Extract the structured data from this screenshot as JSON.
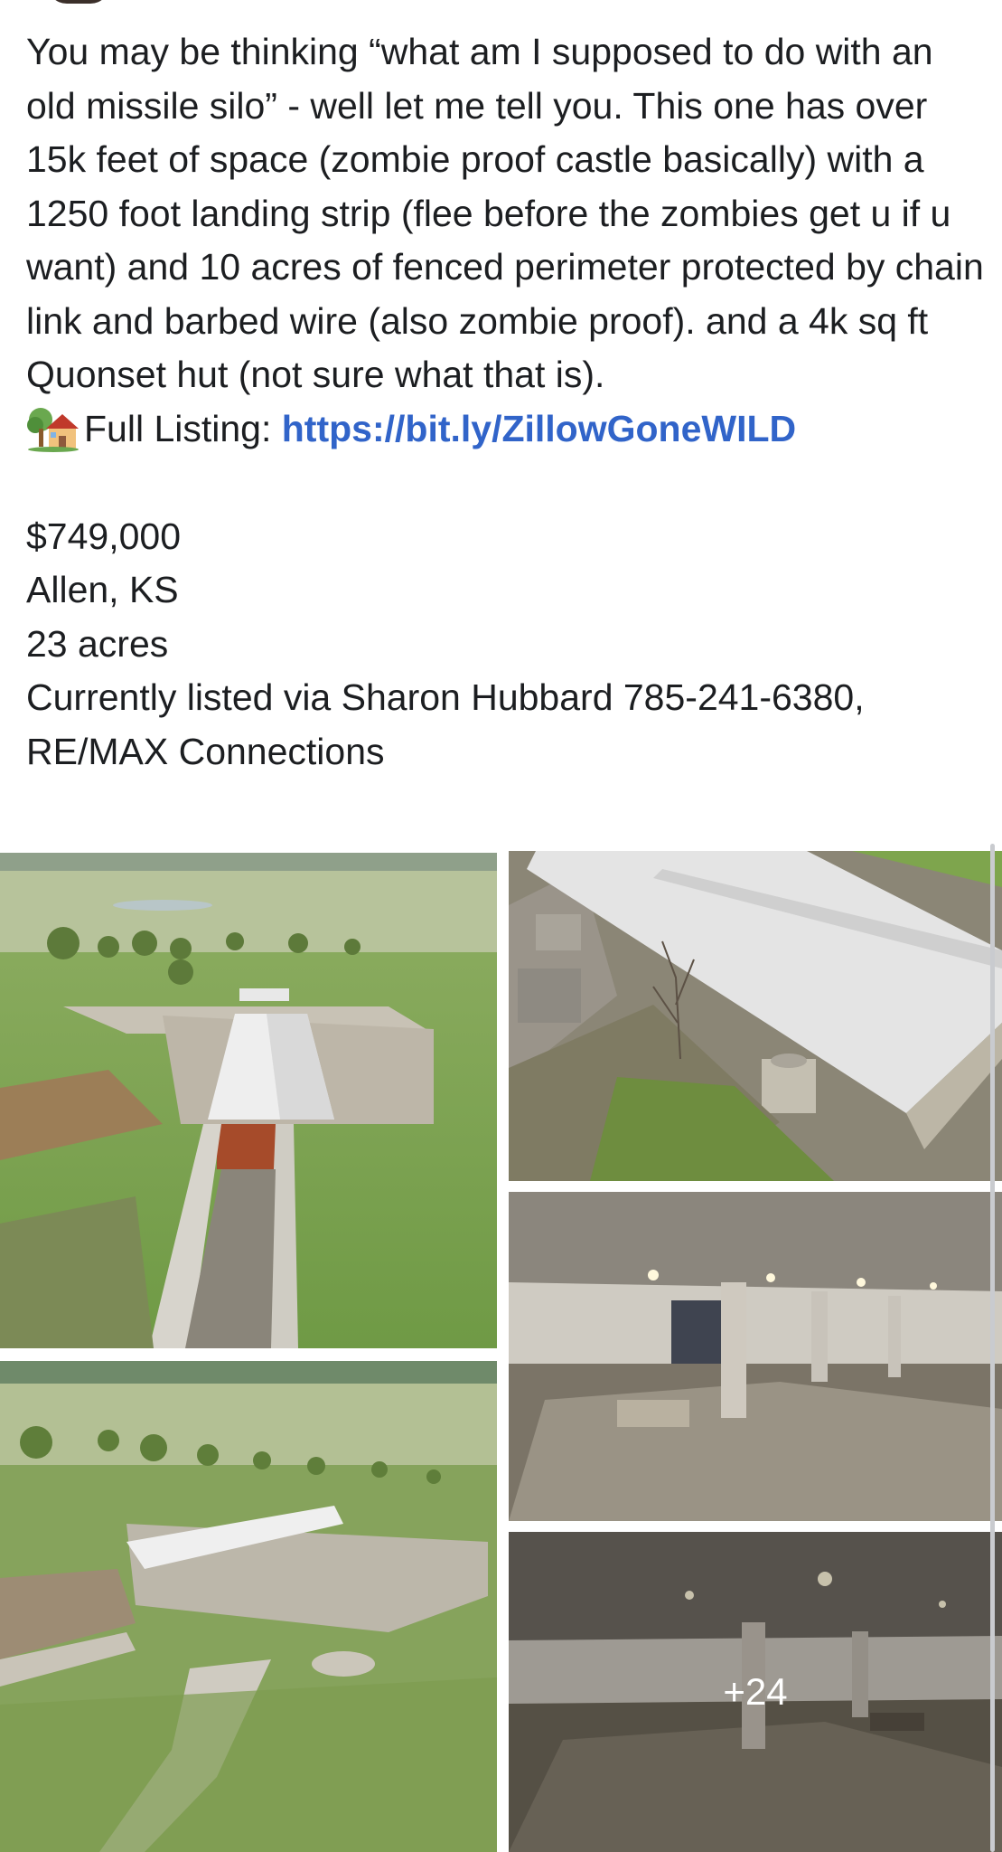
{
  "post": {
    "paragraph": "You may be thinking “what am I supposed to do with an old missile silo” - well let me tell you. This one has over 15k feet of space (zombie proof castle basically) with a 1250 foot landing strip (flee before the zombies get u if u want) and 10 acres of fenced perimeter protected by chain link and barbed wire (also zombie proof). and a 4k sq ft Quonset hut (not sure what that is).",
    "listing_label": "Full Listing: ",
    "listing_link": "https://bit.ly/ZillowGoneWILD",
    "listing_icon": "house-with-garden-icon",
    "price": "$749,000",
    "location": "Allen, KS",
    "acreage": "23 acres",
    "agent_line_1": "Currently listed via Sharon Hubbard 785-241-6380,",
    "agent_line_2": "RE/MAX Connections"
  },
  "photos": {
    "items": [
      {
        "name": "aerial-silo-front"
      },
      {
        "name": "silo-roof-closeup"
      },
      {
        "name": "aerial-silo-wide"
      },
      {
        "name": "underground-hall-1"
      },
      {
        "name": "underground-hall-2"
      }
    ],
    "more_count": "+24"
  },
  "colors": {
    "text": "#1c1e21",
    "link": "#3164c9",
    "background": "#ffffff"
  }
}
